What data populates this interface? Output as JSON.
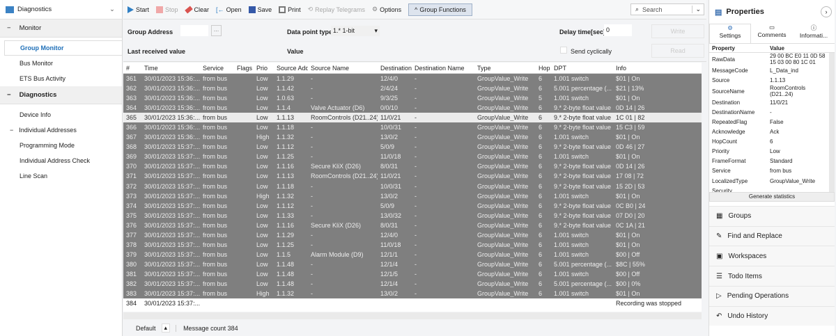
{
  "sidebar": {
    "title": "Diagnostics",
    "sections": [
      {
        "label": "Monitor",
        "items": [
          "Group Monitor",
          "Bus Monitor",
          "ETS Bus Activity"
        ]
      },
      {
        "label": "Diagnostics",
        "items": [
          "Device Info",
          "Individual Addresses",
          "Programming Mode",
          "Individual Address Check",
          "Line Scan"
        ]
      }
    ]
  },
  "toolbar": {
    "start": "Start",
    "stop": "Stop",
    "clear": "Clear",
    "open": "Open",
    "save": "Save",
    "print": "Print",
    "replay": "Replay Telegrams",
    "options": "Options",
    "group_functions": "Group Functions",
    "search_placeholder": "Search"
  },
  "group_functions": {
    "group_address_label": "Group Address",
    "browse": "...",
    "dpt_label": "Data point type",
    "dpt_value": "1.* 1-bit",
    "last_value_label": "Last received value",
    "value_label": "Value",
    "delay_label": "Delay time[sec]",
    "delay_value": "0",
    "send_cyclically": "Send cyclically",
    "write": "Write",
    "read": "Read"
  },
  "table": {
    "columns": [
      "#",
      "Time",
      "Service",
      "Flags",
      "Prio",
      "Source Add",
      "Source Name",
      "Destination",
      "Destination Name",
      "Type",
      "Hop",
      "DPT",
      "Info"
    ],
    "rows": [
      [
        "361",
        "30/01/2023 15:36:...",
        "from bus",
        "",
        "Low",
        "1.1.29",
        "-",
        "12/4/0",
        "-",
        "GroupValue_Write",
        "6",
        "1.001 switch",
        "$01 | On"
      ],
      [
        "362",
        "30/01/2023 15:36:...",
        "from bus",
        "",
        "Low",
        "1.1.42",
        "-",
        "2/4/24",
        "-",
        "GroupValue_Write",
        "6",
        "5.001 percentage (...",
        "$21 | 13%"
      ],
      [
        "363",
        "30/01/2023 15:36:...",
        "from bus",
        "",
        "Low",
        "1.0.63",
        "-",
        "9/3/25",
        "-",
        "GroupValue_Write",
        "5",
        "1.001 switch",
        "$01 | On"
      ],
      [
        "364",
        "30/01/2023 15:36:...",
        "from bus",
        "",
        "Low",
        "1.1.4",
        "Valve Actuator (D6)",
        "0/0/10",
        "-",
        "GroupValue_Write",
        "6",
        "9.* 2-byte float value",
        "0D 14 | 26"
      ],
      [
        "365",
        "30/01/2023 15:36:...",
        "from bus",
        "",
        "Low",
        "1.1.13",
        "RoomControls (D21..24)",
        "11/0/21",
        "-",
        "GroupValue_Write",
        "6",
        "9.* 2-byte float value",
        "1C 01 | 82"
      ],
      [
        "366",
        "30/01/2023 15:36:...",
        "from bus",
        "",
        "Low",
        "1.1.18",
        "-",
        "10/0/31",
        "-",
        "GroupValue_Write",
        "6",
        "9.* 2-byte float value",
        "15 C3 | 59"
      ],
      [
        "367",
        "30/01/2023 15:36:...",
        "from bus",
        "",
        "High",
        "1.1.32",
        "-",
        "13/0/2",
        "-",
        "GroupValue_Write",
        "6",
        "1.001 switch",
        "$01 | On"
      ],
      [
        "368",
        "30/01/2023 15:37:...",
        "from bus",
        "",
        "Low",
        "1.1.12",
        "-",
        "5/0/9",
        "-",
        "GroupValue_Write",
        "6",
        "9.* 2-byte float value",
        "0D 46 | 27"
      ],
      [
        "369",
        "30/01/2023 15:37:...",
        "from bus",
        "",
        "Low",
        "1.1.25",
        "-",
        "11/0/18",
        "-",
        "GroupValue_Write",
        "6",
        "1.001 switch",
        "$01 | On"
      ],
      [
        "370",
        "30/01/2023 15:37:...",
        "from bus",
        "",
        "Low",
        "1.1.16",
        "Secure KliX (D26)",
        "8/0/31",
        "-",
        "GroupValue_Write",
        "6",
        "9.* 2-byte float value",
        "0D 14 | 26"
      ],
      [
        "371",
        "30/01/2023 15:37:...",
        "from bus",
        "",
        "Low",
        "1.1.13",
        "RoomControls (D21..24)",
        "11/0/21",
        "-",
        "GroupValue_Write",
        "6",
        "9.* 2-byte float value",
        "17 08 | 72"
      ],
      [
        "372",
        "30/01/2023 15:37:...",
        "from bus",
        "",
        "Low",
        "1.1.18",
        "-",
        "10/0/31",
        "-",
        "GroupValue_Write",
        "6",
        "9.* 2-byte float value",
        "15 2D | 53"
      ],
      [
        "373",
        "30/01/2023 15:37:...",
        "from bus",
        "",
        "High",
        "1.1.32",
        "-",
        "13/0/2",
        "-",
        "GroupValue_Write",
        "6",
        "1.001 switch",
        "$01 | On"
      ],
      [
        "374",
        "30/01/2023 15:37:...",
        "from bus",
        "",
        "Low",
        "1.1.12",
        "-",
        "5/0/9",
        "-",
        "GroupValue_Write",
        "6",
        "9.* 2-byte float value",
        "0C B0 | 24"
      ],
      [
        "375",
        "30/01/2023 15:37:...",
        "from bus",
        "",
        "Low",
        "1.1.33",
        "-",
        "13/0/32",
        "-",
        "GroupValue_Write",
        "6",
        "9.* 2-byte float value",
        "07 D0 | 20"
      ],
      [
        "376",
        "30/01/2023 15:37:...",
        "from bus",
        "",
        "Low",
        "1.1.16",
        "Secure KliX (D26)",
        "8/0/31",
        "-",
        "GroupValue_Write",
        "6",
        "9.* 2-byte float value",
        "0C 1A | 21"
      ],
      [
        "377",
        "30/01/2023 15:37:...",
        "from bus",
        "",
        "Low",
        "1.1.29",
        "-",
        "12/4/0",
        "-",
        "GroupValue_Write",
        "6",
        "1.001 switch",
        "$01 | On"
      ],
      [
        "378",
        "30/01/2023 15:37:...",
        "from bus",
        "",
        "Low",
        "1.1.25",
        "-",
        "11/0/18",
        "-",
        "GroupValue_Write",
        "6",
        "1.001 switch",
        "$01 | On"
      ],
      [
        "379",
        "30/01/2023 15:37:...",
        "from bus",
        "",
        "Low",
        "1.1.5",
        "Alarm Module (D9)",
        "12/1/1",
        "-",
        "GroupValue_Write",
        "6",
        "1.001 switch",
        "$00 | Off"
      ],
      [
        "380",
        "30/01/2023 15:37:...",
        "from bus",
        "",
        "Low",
        "1.1.48",
        "-",
        "12/1/4",
        "-",
        "GroupValue_Write",
        "6",
        "5.001 percentage (...",
        "$8C | 55%"
      ],
      [
        "381",
        "30/01/2023 15:37:...",
        "from bus",
        "",
        "Low",
        "1.1.48",
        "-",
        "12/1/5",
        "-",
        "GroupValue_Write",
        "6",
        "1.001 switch",
        "$00 | Off"
      ],
      [
        "382",
        "30/01/2023 15:37:...",
        "from bus",
        "",
        "Low",
        "1.1.48",
        "-",
        "12/1/4",
        "-",
        "GroupValue_Write",
        "6",
        "5.001 percentage (...",
        "$00 | 0%"
      ],
      [
        "383",
        "30/01/2023 15:37:...",
        "from bus",
        "",
        "High",
        "1.1.32",
        "-",
        "13/0/2",
        "-",
        "GroupValue_Write",
        "6",
        "1.001 switch",
        "$01 | On"
      ],
      [
        "384",
        "30/01/2023 15:37:...",
        "",
        "",
        "",
        "",
        "",
        "",
        "",
        "",
        "",
        "",
        "Recording was stopped"
      ]
    ]
  },
  "status": {
    "profile": "Default",
    "message_count": "Message count 384"
  },
  "properties": {
    "title": "Properties",
    "tabs": [
      "Settings",
      "Comments",
      "Informati..."
    ],
    "col_property": "Property",
    "col_value": "Value",
    "rows": [
      [
        "RawData",
        "29 00 BC E0 11 0D 58 15 03 00 80 1C 01"
      ],
      [
        "MessageCode",
        "L_Data_ind"
      ],
      [
        "Source",
        "1.1.13"
      ],
      [
        "SourceName",
        "RoomControls (D21..24)"
      ],
      [
        "Destination",
        "11/0/21"
      ],
      [
        "DestinationName",
        "-"
      ],
      [
        "RepeatedFlag",
        "False"
      ],
      [
        "Acknowledge",
        "Ack"
      ],
      [
        "HopCount",
        "6"
      ],
      [
        "Priority",
        "Low"
      ],
      [
        "FrameFormat",
        "Standard"
      ],
      [
        "Service",
        "from bus"
      ],
      [
        "LocalizedType",
        "GroupValue_Write"
      ],
      [
        "Security",
        ""
      ]
    ],
    "generate": "Generate statistics"
  },
  "panels": [
    "Groups",
    "Find and Replace",
    "Workspaces",
    "Todo Items",
    "Pending Operations",
    "Undo History"
  ]
}
